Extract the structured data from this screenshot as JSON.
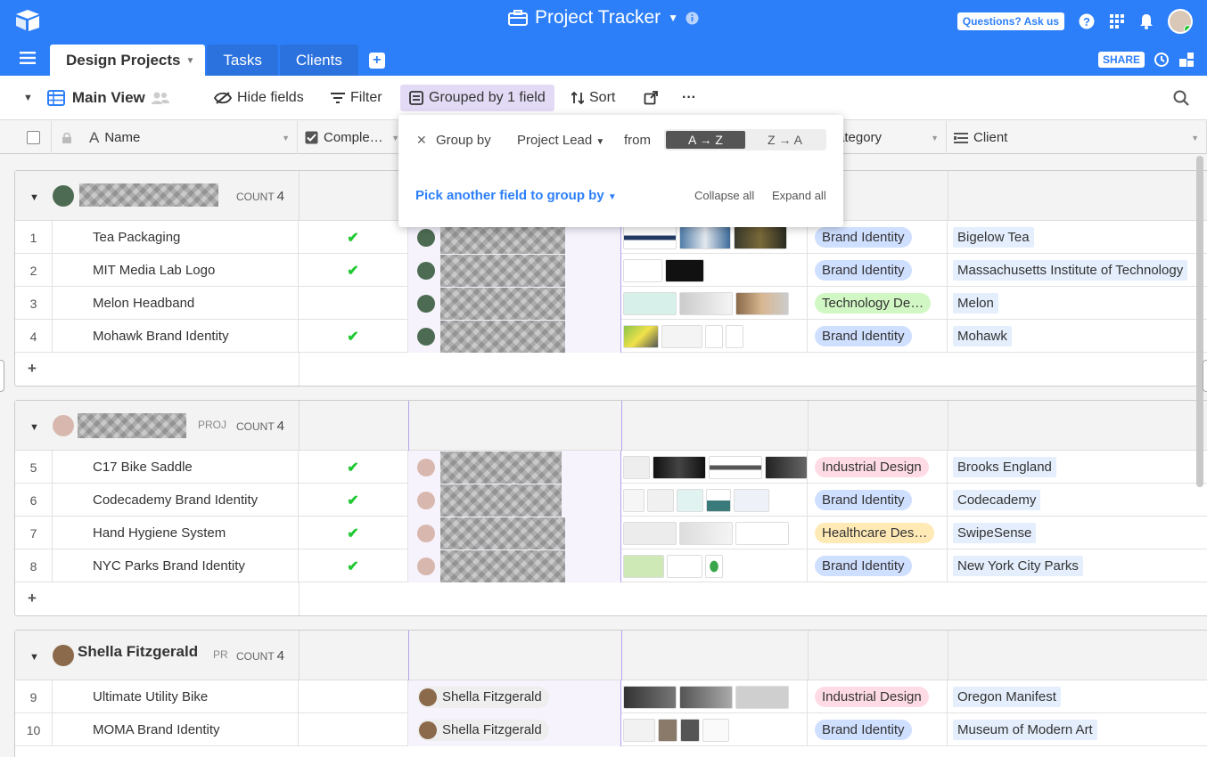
{
  "app": {
    "title": "Project Tracker",
    "help_button": "Questions? Ask us",
    "share_label": "SHARE"
  },
  "tabs": [
    {
      "label": "Design Projects"
    },
    {
      "label": "Tasks"
    },
    {
      "label": "Clients"
    }
  ],
  "toolbar": {
    "view_name": "Main View",
    "hide_fields": "Hide fields",
    "filter": "Filter",
    "grouped": "Grouped by 1 field",
    "sort": "Sort",
    "more": "···"
  },
  "columns": {
    "name": "Name",
    "complete": "Comple…",
    "category": "ategory",
    "client": "Client"
  },
  "group_popup": {
    "group_by": "Group by",
    "field": "Project Lead",
    "from": "from",
    "asc": "A → Z",
    "desc": "Z → A",
    "pick": "Pick another field to group by",
    "collapse": "Collapse all",
    "expand": "Expand all"
  },
  "groups": [
    {
      "name": "",
      "field_prefix": "",
      "count_label": "COUNT",
      "count": "4",
      "rows": [
        {
          "num": "1",
          "name": "Tea Packaging",
          "done": "✔",
          "category": "Brand Identity",
          "client": "Bigelow Tea"
        },
        {
          "num": "2",
          "name": "MIT Media Lab Logo",
          "done": "✔",
          "category": "Brand Identity",
          "client": "Massachusetts Institute of Technology"
        },
        {
          "num": "3",
          "name": "Melon Headband",
          "done": "",
          "category": "Technology De…",
          "client": "Melon"
        },
        {
          "num": "4",
          "name": "Mohawk Brand Identity",
          "done": "✔",
          "category": "Brand Identity",
          "client": "Mohawk"
        }
      ]
    },
    {
      "name": "",
      "field_prefix": "PROJ",
      "count_label": "COUNT",
      "count": "4",
      "rows": [
        {
          "num": "5",
          "name": "C17 Bike Saddle",
          "done": "✔",
          "category": "Industrial Design",
          "client": "Brooks England"
        },
        {
          "num": "6",
          "name": "Codecademy Brand Identity",
          "done": "✔",
          "category": "Brand Identity",
          "client": "Codecademy"
        },
        {
          "num": "7",
          "name": "Hand Hygiene System",
          "done": "✔",
          "category": "Healthcare Des…",
          "client": "SwipeSense"
        },
        {
          "num": "8",
          "name": "NYC Parks Brand Identity",
          "done": "✔",
          "category": "Brand Identity",
          "client": "New York City Parks"
        }
      ]
    },
    {
      "name": "Shella Fitzgerald",
      "field_prefix": "PR",
      "count_label": "COUNT",
      "count": "4",
      "rows": [
        {
          "num": "9",
          "name": "Ultimate Utility Bike",
          "done": "",
          "lead": "Shella Fitzgerald",
          "category": "Industrial Design",
          "client": "Oregon Manifest"
        },
        {
          "num": "10",
          "name": "MOMA Brand Identity",
          "done": "",
          "lead": "Shella Fitzgerald",
          "category": "Brand Identity",
          "client": "Museum of Modern Art"
        }
      ]
    }
  ],
  "add_row": "+",
  "colors": {
    "accent": "#2d7ff9",
    "group_highlight": "#e3dbf5",
    "check": "#20c933"
  }
}
